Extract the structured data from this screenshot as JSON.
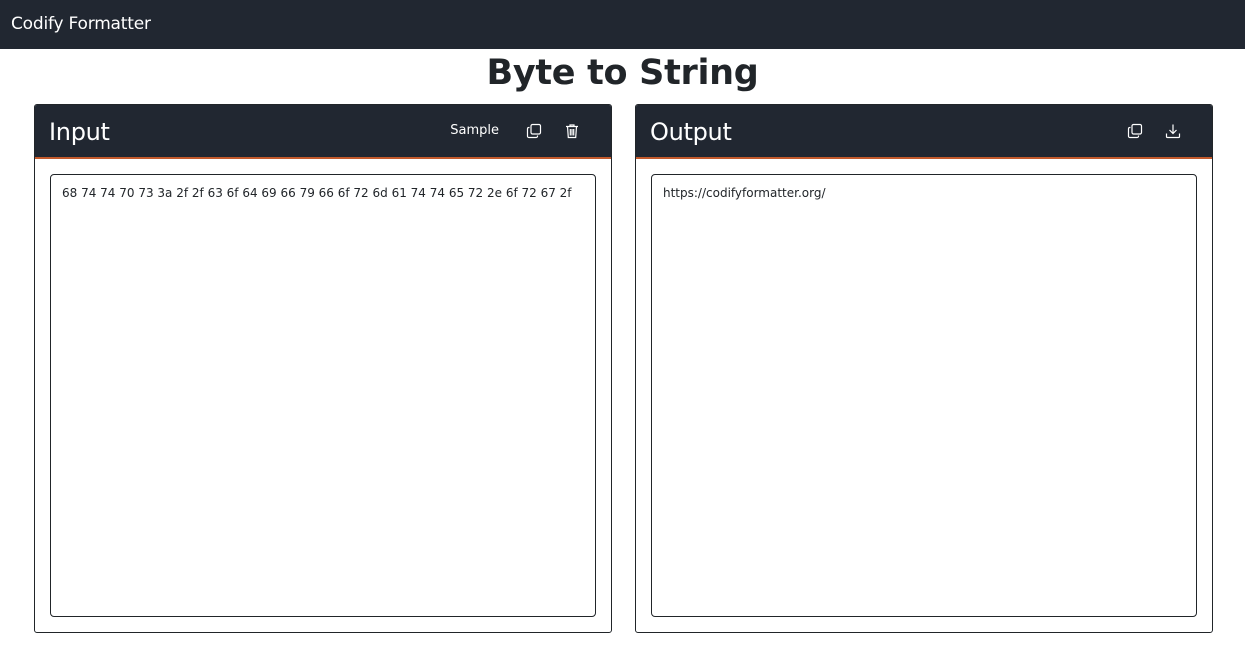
{
  "navbar": {
    "brand": "Codify Formatter"
  },
  "page": {
    "title": "Byte to String"
  },
  "input_panel": {
    "title": "Input",
    "sample_label": "Sample",
    "icons": [
      "copy-icon",
      "trash-icon"
    ],
    "value": "68 74 74 70 73 3a 2f 2f 63 6f 64 69 66 79 66 6f 72 6d 61 74 74 65 72 2e 6f 72 67 2f"
  },
  "output_panel": {
    "title": "Output",
    "icons": [
      "copy-icon",
      "download-icon"
    ],
    "value": "https://codifyformatter.org/"
  },
  "colors": {
    "header_bg": "#212731",
    "accent_border": "#c35a2c",
    "text": "#212529",
    "white": "#ffffff"
  }
}
